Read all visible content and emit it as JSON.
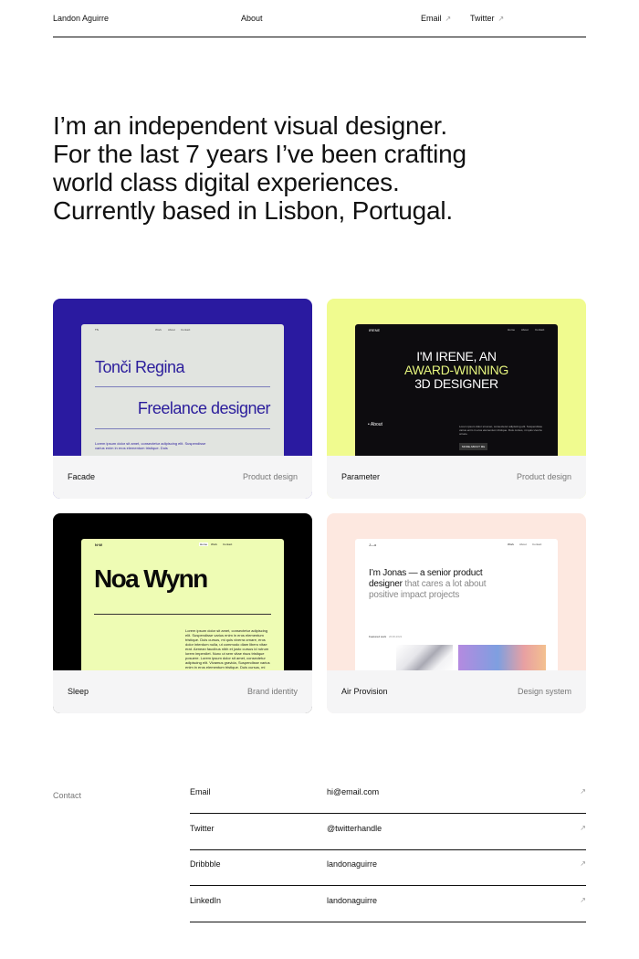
{
  "header": {
    "name": "Landon Aguirre",
    "about": "About",
    "email": "Email",
    "twitter": "Twitter",
    "arrow": "↗"
  },
  "hero": {
    "lines": [
      "I’m an independent visual designer.",
      "For the last 7 years I’ve been crafting",
      "world class digital experiences.",
      "Currently based in Lisbon, Portugal."
    ]
  },
  "projects": [
    {
      "title": "Facade",
      "tag": "Product design",
      "bg": "#2a1aa0",
      "preview": {
        "logo": "TS",
        "nav": [
          "Work",
          "About",
          "Contact"
        ],
        "heading1": "Tonči Regina",
        "heading2": "Freelance designer",
        "body": "Lorem ipsum dolor sit amet, consectetur adipiscing elit. Suspendisse varius enim in eros elementum tristique. Duis"
      }
    },
    {
      "title": "Parameter",
      "tag": "Product design",
      "bg": "#f0fb8f",
      "preview": {
        "logo": "IRENE",
        "nav": [
          "Home",
          "About",
          "Contact"
        ],
        "line1": "I'M IRENE, AN",
        "line2": "AWARD-WINNING",
        "line3": "3D DESIGNER",
        "about": "• About",
        "body": "Lorem ipsum dolor sit amet, consectetur adipiscing elit. Suspendisse varius enim in eros elementum tristique. Duis cursus, mi quis viverra ornare.",
        "button": "MORE ABOUT ME"
      }
    },
    {
      "title": "Sleep",
      "tag": "Brand identity",
      "bg": "#000000",
      "preview": {
        "logo": "N·W",
        "nav": [
          "Home",
          "Work",
          "Contact"
        ],
        "heading": "Noa Wynn",
        "body": "Lorem ipsum dolor sit amet, consectetur adipiscing elit. Suspendisse varius enim in eros elementum tristique. Duis cursus, mi quis viverra ornare, eros dolor interdum nulla, ut commodo diam libero vitae erat. Aenean faucibus nibh et justo cursus id rutrum lorem imperdiet. Nunc ut sem vitae risus tristique posuere. Lorem ipsum dolor sit amet, consectetur adipiscing elit. Vivamus gravida, Suspendisse varius enim in eros elementum tristique. Duis cursus, mi quis viverra ornare, eros dolor interdum nulla, ut commodo diam libero vitae erat. Vivamus gravida nunc ut sem."
      }
    },
    {
      "title": "Air Provision",
      "tag": "Design system",
      "bg": "#fde8e0",
      "preview": {
        "logo": "J—o",
        "nav": [
          "Work",
          "About",
          "Contact"
        ],
        "h_dark1": "I’m Jonas — a senior product",
        "h_dark2": "designer",
        "h_grey2": " that cares a lot about",
        "h_grey3": "positive impact projects",
        "caption1": "Featured work",
        "caption2": "2018-2022"
      }
    }
  ],
  "contact": {
    "label": "Contact",
    "rows": [
      {
        "label": "Email",
        "value": "hi@email.com",
        "arrow": "↗"
      },
      {
        "label": "Twitter",
        "value": "@twitterhandle",
        "arrow": "↗"
      },
      {
        "label": "Dribbble",
        "value": "landonaguirre",
        "arrow": "↗"
      },
      {
        "label": "LinkedIn",
        "value": "landonaguirre",
        "arrow": "↗"
      }
    ]
  }
}
